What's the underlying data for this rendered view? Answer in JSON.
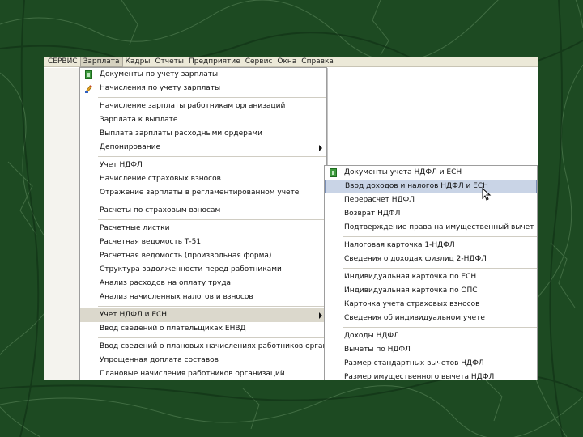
{
  "menubar": {
    "items": [
      "СЕРВИС",
      "Зарплата",
      "Кадры",
      "Отчеты",
      "Предприятие",
      "Сервис",
      "Окна",
      "Справка"
    ],
    "active_index": 1
  },
  "menu_main": {
    "items": [
      {
        "label": "Документы по учету зарплаты",
        "icon": "green-doc-icon"
      },
      {
        "label": "Начисления по учету зарплаты",
        "icon": "pencil-icon"
      },
      {
        "label": "Начисление зарплаты работникам организаций"
      },
      {
        "label": "Зарплата к выплате"
      },
      {
        "label": "Выплата зарплаты расходными ордерами"
      },
      {
        "label": "Депонирование",
        "submenu": true
      },
      {
        "label": "Учет НДФЛ"
      },
      {
        "label": "Начисление страховых взносов"
      },
      {
        "label": "Отражение зарплаты в регламентированном учете"
      },
      {
        "label": "Расчеты по страховым взносам"
      },
      {
        "label": "Расчетные листки"
      },
      {
        "label": "Расчетная ведомость Т-51"
      },
      {
        "label": "Расчетная ведомость (произвольная форма)"
      },
      {
        "label": "Структура задолженности перед работниками"
      },
      {
        "label": "Анализ расходов на оплату труда"
      },
      {
        "label": "Анализ начисленных налогов и взносов"
      },
      {
        "label": "Учет НДФЛ и ЕСН",
        "submenu": true,
        "highlighted": true
      },
      {
        "label": "Ввод сведений о плательщиках ЕНВД"
      },
      {
        "label": "Ввод сведений о плановых начислениях работников организаций"
      },
      {
        "label": "Упрощенная доплата составов"
      },
      {
        "label": "Плановые начисления работников организаций"
      }
    ]
  },
  "menu_sub": {
    "items": [
      {
        "label": "Документы учета НДФЛ и ЕСН",
        "icon": "green-doc-icon"
      },
      {
        "label": "Ввод доходов и налогов НДФЛ и ЕСН",
        "highlighted": true
      },
      {
        "label": "Перерасчет НДФЛ"
      },
      {
        "label": "Возврат НДФЛ"
      },
      {
        "label": "Подтверждение права на имущественный вычет"
      },
      {
        "label": "Налоговая карточка 1-НДФЛ"
      },
      {
        "label": "Сведения о доходах физлиц 2-НДФЛ"
      },
      {
        "label": "Индивидуальная карточка по ЕСН"
      },
      {
        "label": "Индивидуальная карточка по ОПС"
      },
      {
        "label": "Карточка учета страховых взносов"
      },
      {
        "label": "Сведения об индивидуальном учете"
      },
      {
        "label": "Доходы НДФЛ"
      },
      {
        "label": "Вычеты по НДФЛ"
      },
      {
        "label": "Размер стандартных вычетов НДФЛ"
      },
      {
        "label": "Размер имущественного вычета НДФЛ"
      }
    ]
  },
  "colors": {
    "background": "#1d4a22",
    "menubar": "#ece9d8",
    "highlight_blue": "#c9d4e6",
    "highlight_grey": "#dbd8cc"
  }
}
